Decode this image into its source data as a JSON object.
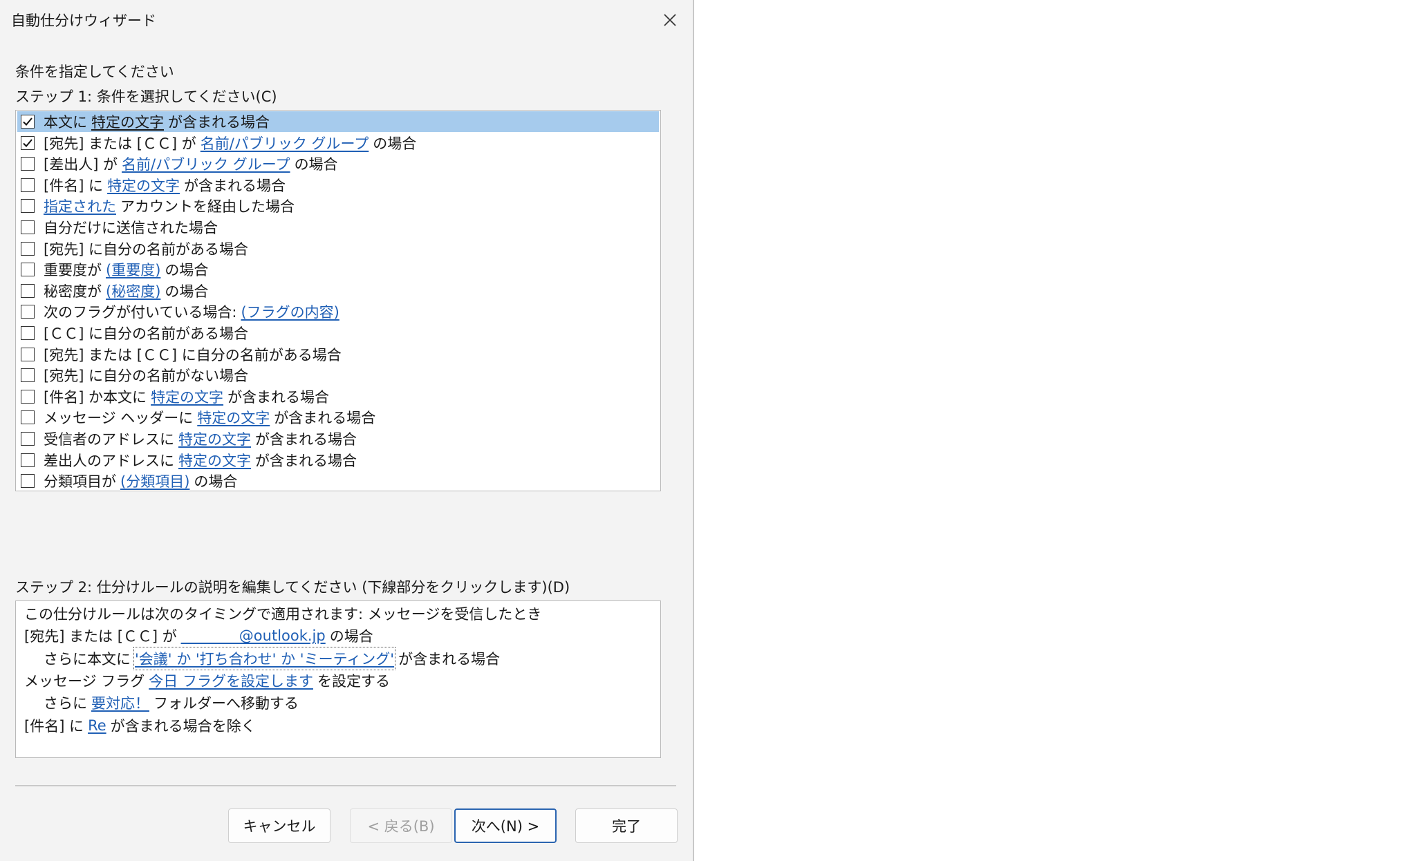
{
  "window": {
    "title": "自動仕分けウィザード"
  },
  "prompt": "条件を指定してください",
  "step1": {
    "label": "ステップ 1: 条件を選択してください(C)",
    "items": [
      {
        "checked": true,
        "selected": true,
        "parts": [
          {
            "t": "本文に"
          },
          {
            "t": "特定の文字",
            "link": true
          },
          {
            "t": "が含まれる場合"
          }
        ]
      },
      {
        "checked": true,
        "parts": [
          {
            "t": "[宛先] または [ＣＣ] が"
          },
          {
            "t": "名前/パブリック グループ",
            "link": true
          },
          {
            "t": "の場合"
          }
        ]
      },
      {
        "checked": false,
        "parts": [
          {
            "t": "[差出人] が"
          },
          {
            "t": "名前/パブリック グループ",
            "link": true
          },
          {
            "t": "の場合"
          }
        ]
      },
      {
        "checked": false,
        "parts": [
          {
            "t": "[件名] に"
          },
          {
            "t": "特定の文字",
            "link": true
          },
          {
            "t": "が含まれる場合"
          }
        ]
      },
      {
        "checked": false,
        "parts": [
          {
            "t": "指定された",
            "link": true
          },
          {
            "t": "アカウントを経由した場合"
          }
        ]
      },
      {
        "checked": false,
        "parts": [
          {
            "t": "自分だけに送信された場合"
          }
        ]
      },
      {
        "checked": false,
        "parts": [
          {
            "t": "[宛先] に自分の名前がある場合"
          }
        ]
      },
      {
        "checked": false,
        "parts": [
          {
            "t": "重要度が"
          },
          {
            "t": "(重要度)",
            "link": true
          },
          {
            "t": "の場合"
          }
        ]
      },
      {
        "checked": false,
        "parts": [
          {
            "t": "秘密度が"
          },
          {
            "t": "(秘密度)",
            "link": true
          },
          {
            "t": "の場合"
          }
        ]
      },
      {
        "checked": false,
        "parts": [
          {
            "t": "次のフラグが付いている場合:"
          },
          {
            "t": "(フラグの内容)",
            "link": true
          }
        ]
      },
      {
        "checked": false,
        "parts": [
          {
            "t": "[ＣＣ] に自分の名前がある場合"
          }
        ]
      },
      {
        "checked": false,
        "parts": [
          {
            "t": "[宛先] または [ＣＣ] に自分の名前がある場合"
          }
        ]
      },
      {
        "checked": false,
        "parts": [
          {
            "t": "[宛先] に自分の名前がない場合"
          }
        ]
      },
      {
        "checked": false,
        "parts": [
          {
            "t": "[件名] か本文に"
          },
          {
            "t": "特定の文字",
            "link": true
          },
          {
            "t": "が含まれる場合"
          }
        ]
      },
      {
        "checked": false,
        "parts": [
          {
            "t": "メッセージ ヘッダーに"
          },
          {
            "t": "特定の文字",
            "link": true
          },
          {
            "t": "が含まれる場合"
          }
        ]
      },
      {
        "checked": false,
        "parts": [
          {
            "t": "受信者のアドレスに"
          },
          {
            "t": "特定の文字",
            "link": true
          },
          {
            "t": "が含まれる場合"
          }
        ]
      },
      {
        "checked": false,
        "parts": [
          {
            "t": "差出人のアドレスに"
          },
          {
            "t": "特定の文字",
            "link": true
          },
          {
            "t": "が含まれる場合"
          }
        ]
      },
      {
        "checked": false,
        "parts": [
          {
            "t": "分類項目が"
          },
          {
            "t": "(分類項目)",
            "link": true
          },
          {
            "t": "の場合"
          }
        ]
      }
    ]
  },
  "step2": {
    "label": "ステップ 2: 仕分けルールの説明を編集してください (下線部分をクリックします)(D)",
    "lines": [
      {
        "indent": 0,
        "parts": [
          {
            "t": "この仕分けルールは次のタイミングで適用されます: メッセージを受信したとき"
          }
        ]
      },
      {
        "indent": 0,
        "parts": [
          {
            "t": "[宛先] または [ＣＣ] が"
          },
          {
            "t": "________@outlook.jp",
            "link": true
          },
          {
            "t": "の場合"
          }
        ]
      },
      {
        "indent": 1,
        "parts": [
          {
            "t": "さらに本文に"
          },
          {
            "t": "'会議' か '打ち合わせ' か 'ミーティング'",
            "link": true,
            "focus": true
          },
          {
            "t": "が含まれる場合"
          }
        ]
      },
      {
        "indent": 0,
        "parts": [
          {
            "t": "メッセージ フラグ"
          },
          {
            "t": "今日 フラグを設定します",
            "link": true
          },
          {
            "t": "を設定する"
          }
        ]
      },
      {
        "indent": 1,
        "parts": [
          {
            "t": "さらに"
          },
          {
            "t": "要対応！",
            "link": true
          },
          {
            "t": "フォルダーへ移動する"
          }
        ]
      },
      {
        "indent": 0,
        "parts": [
          {
            "t": "[件名] に"
          },
          {
            "t": "Re",
            "link": true
          },
          {
            "t": "が含まれる場合を除く"
          }
        ]
      }
    ]
  },
  "buttons": {
    "cancel": "キャンセル",
    "back": "< 戻る(B)",
    "next": "次へ(N) >",
    "finish": "完了"
  }
}
